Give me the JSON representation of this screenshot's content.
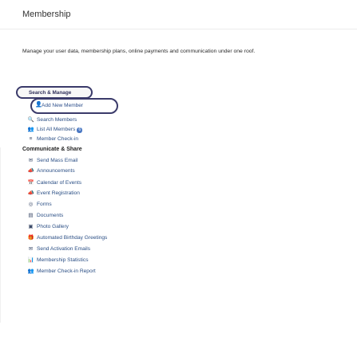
{
  "header": {
    "title": "Membership"
  },
  "description": "Manage your user data, membership plans, online payments and communication under one roof.",
  "manage_menu": {
    "label": "Search & Manage",
    "items": [
      {
        "icon": "user-add-icon",
        "glyph": "👤",
        "label": "Add New Member"
      },
      {
        "icon": "search-icon",
        "glyph": "🔍",
        "label": "Search Members"
      },
      {
        "icon": "users-icon",
        "glyph": "👥",
        "label": "List All Members",
        "badge": "6"
      },
      {
        "icon": "checkin-icon",
        "glyph": "≡",
        "label": "Member Check-in"
      }
    ]
  },
  "communicate": {
    "title": "Communicate & Share",
    "items": [
      {
        "icon": "mail-icon",
        "glyph": "✉",
        "label": "Send Mass Email"
      },
      {
        "icon": "megaphone-icon",
        "glyph": "📣",
        "label": "Announcements"
      },
      {
        "icon": "calendar-icon",
        "glyph": "📅",
        "label": "Calendar of Events"
      },
      {
        "icon": "megaphone-icon",
        "glyph": "📣",
        "label": "Event Registration"
      },
      {
        "icon": "form-icon",
        "glyph": "◎",
        "label": "Forms"
      },
      {
        "icon": "document-icon",
        "glyph": "▤",
        "label": "Documents"
      },
      {
        "icon": "photo-icon",
        "glyph": "▣",
        "label": "Photo Gallery"
      },
      {
        "icon": "gift-icon",
        "glyph": "🎁",
        "label": "Automated Birthday Greetings"
      },
      {
        "icon": "mail-icon",
        "glyph": "✉",
        "label": "Send Activation Emails"
      },
      {
        "icon": "stats-icon",
        "glyph": "📊",
        "label": "Membership Statistics"
      },
      {
        "icon": "users-icon",
        "glyph": "👥",
        "label": "Member Check-in Report"
      }
    ]
  }
}
